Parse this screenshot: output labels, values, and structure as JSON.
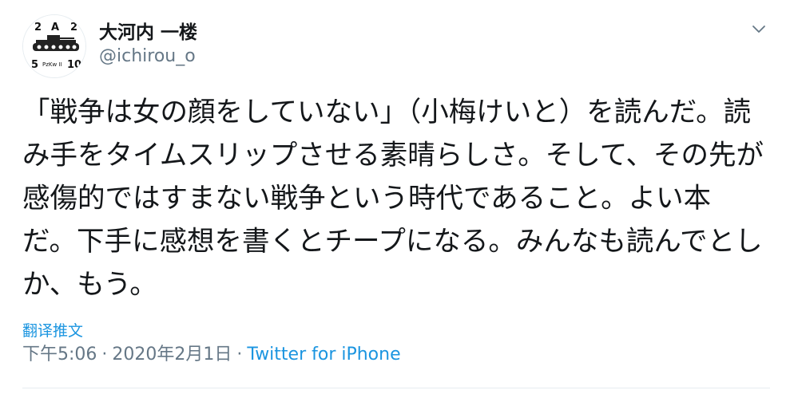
{
  "author": {
    "display_name": "大河内 一楼",
    "screen_name": "@ichirou_o",
    "avatar": {
      "icon": "tank-avatar-icon",
      "labels": {
        "top_left": "2",
        "top_center": "A",
        "top_right": "2",
        "bottom_left": "5",
        "bottom_center": "PzKw II",
        "bottom_right": "10"
      }
    }
  },
  "menu": {
    "icon": "chevron-down-icon"
  },
  "tweet": {
    "text": "「戦争は女の顔をしていない」（小梅けいと）を読んだ。読み手をタイムスリップさせる素晴らしさ。そして、その先が感傷的ではすまない戦争という時代であること。よい本だ。下手に感想を書くとチープになる。みんなも読んでとしか、もう。"
  },
  "translate": {
    "label": "翻译推文"
  },
  "meta": {
    "time": "下午5:06",
    "separator": "·",
    "date": "2020年2月1日",
    "source": "Twitter for iPhone"
  },
  "colors": {
    "text": "#14171a",
    "secondary": "#657786",
    "link": "#1b95e0",
    "divider": "#e6ecf0"
  }
}
